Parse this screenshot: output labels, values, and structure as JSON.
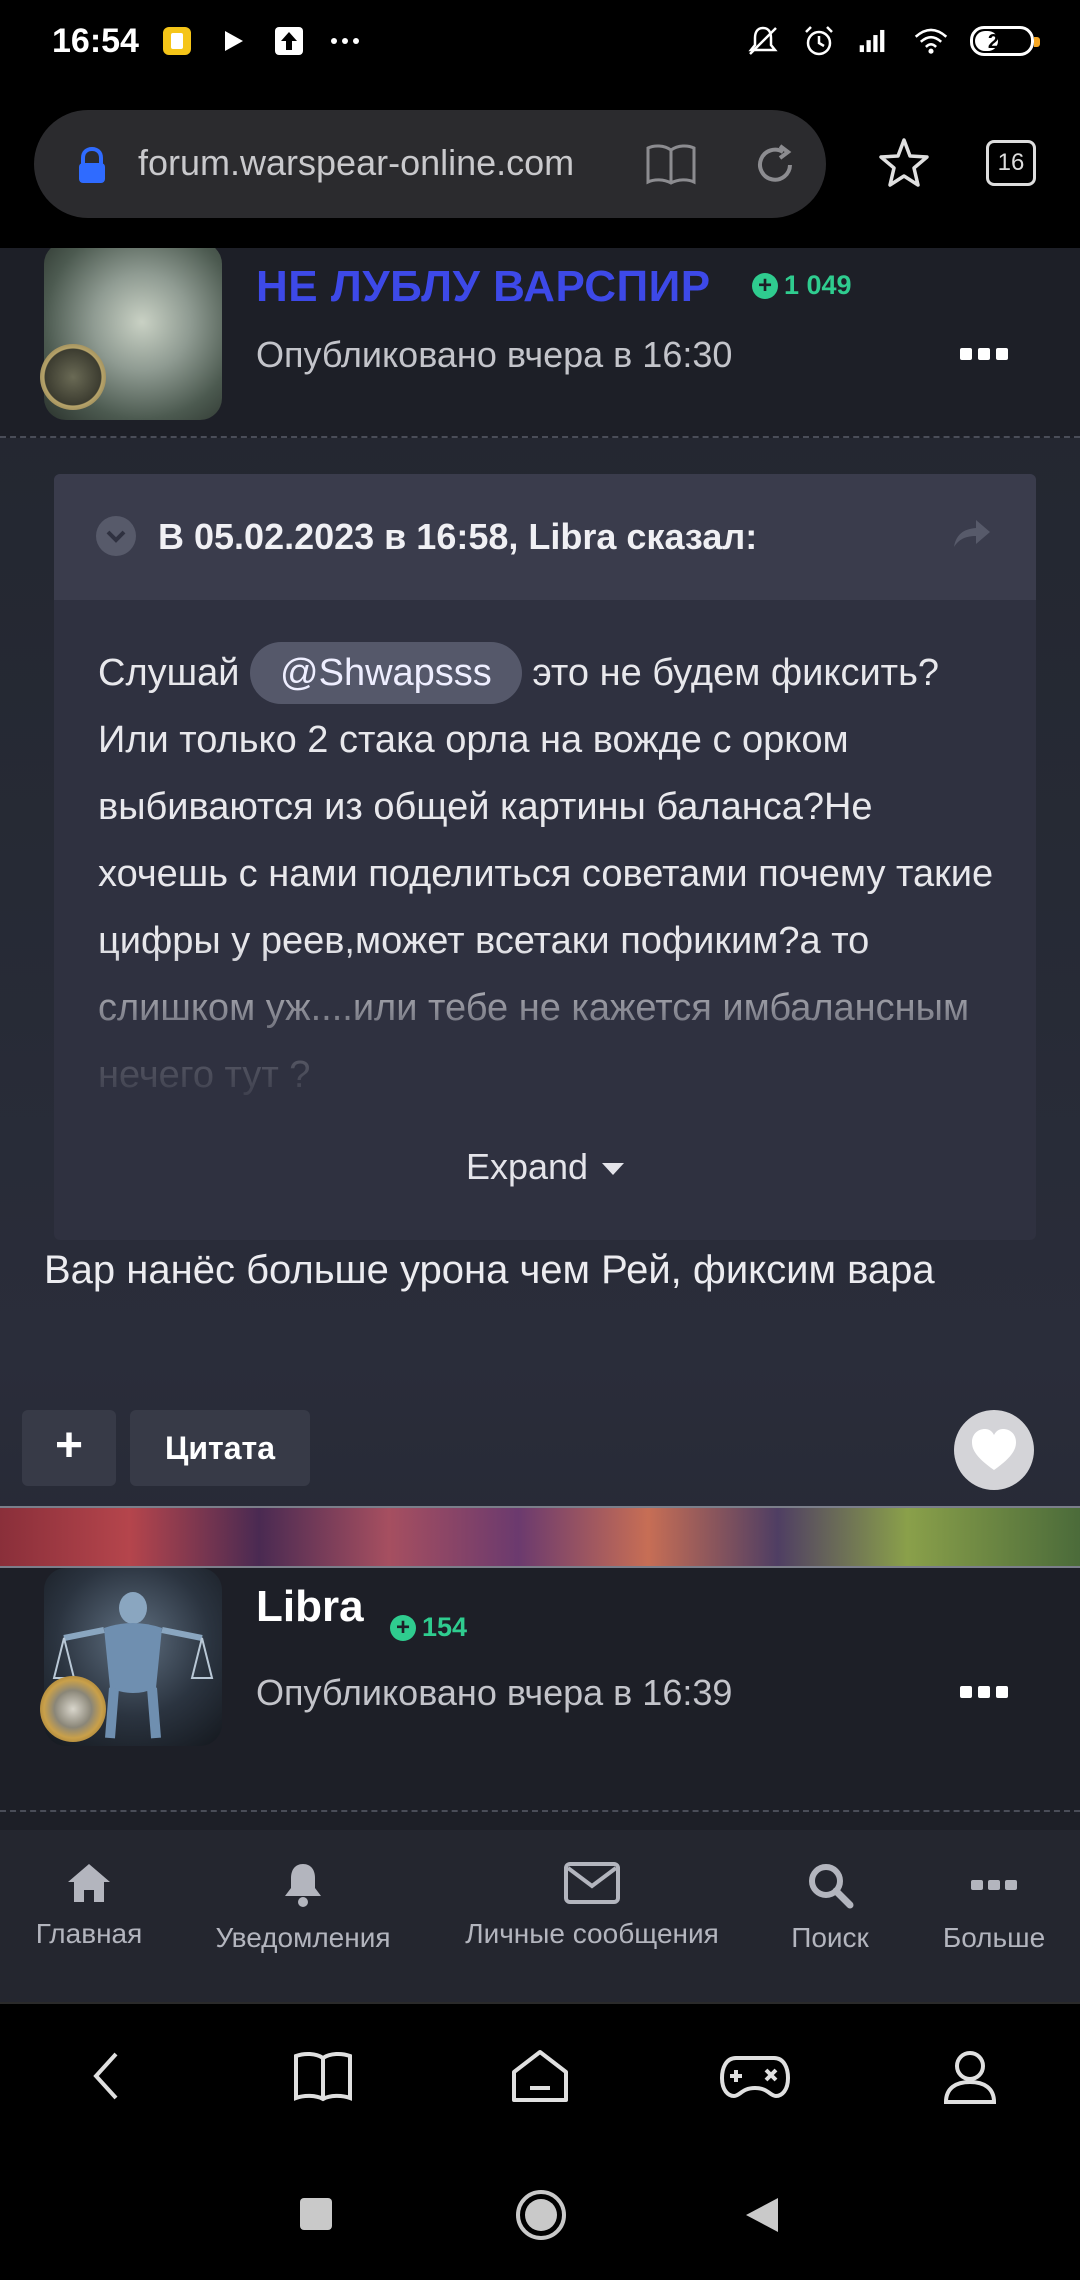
{
  "status_bar": {
    "time": "16:54",
    "battery": "24",
    "left_icons": [
      "app-notification-icon",
      "play-icon",
      "upload-icon",
      "more-icon"
    ],
    "right_icons": [
      "mute-icon",
      "alarm-icon",
      "signal-icon",
      "wifi-icon",
      "battery-icon"
    ]
  },
  "browser": {
    "url": "forum.warspear-online.com",
    "tab_count": "16"
  },
  "post1": {
    "author": "НЕ ЛУБЛУ ВАРСПИР",
    "reputation": "1 049",
    "published": "Опубликовано вчера в 16:30",
    "quote": {
      "header": "В 05.02.2023 в 16:58, Libra сказал:",
      "text_start": "Слушай ",
      "mention": "@Shwapsss",
      "text_rest": " это не будем фиксить?Или только 2 стака орла на вожде с орком выбиваются из общей картины баланса?Не хочешь с нами поделиться советами почему такие цифры у реев,может всетаки пофиким?а то слишком уж....или тебе не кажется имбалансным нечего тут ?",
      "expand_label": "Expand"
    },
    "reply": "Вар нанёс больше урона чем Рей, фиксим вара",
    "plus_label": "+",
    "quote_button": "Цитата"
  },
  "post2": {
    "author": "Libra",
    "reputation": "154",
    "published": "Опубликовано вчера в 16:39"
  },
  "forum_nav": [
    {
      "label": "Главная",
      "icon": "home-icon"
    },
    {
      "label": "Уведомления",
      "icon": "bell-icon"
    },
    {
      "label": "Личные сообщения",
      "icon": "envelope-icon"
    },
    {
      "label": "Поиск",
      "icon": "search-icon"
    },
    {
      "label": "Больше",
      "icon": "more-icon"
    }
  ],
  "colors": {
    "author1": "#3d49e8",
    "reputation": "#2fcc8f",
    "background": "#23262f"
  }
}
